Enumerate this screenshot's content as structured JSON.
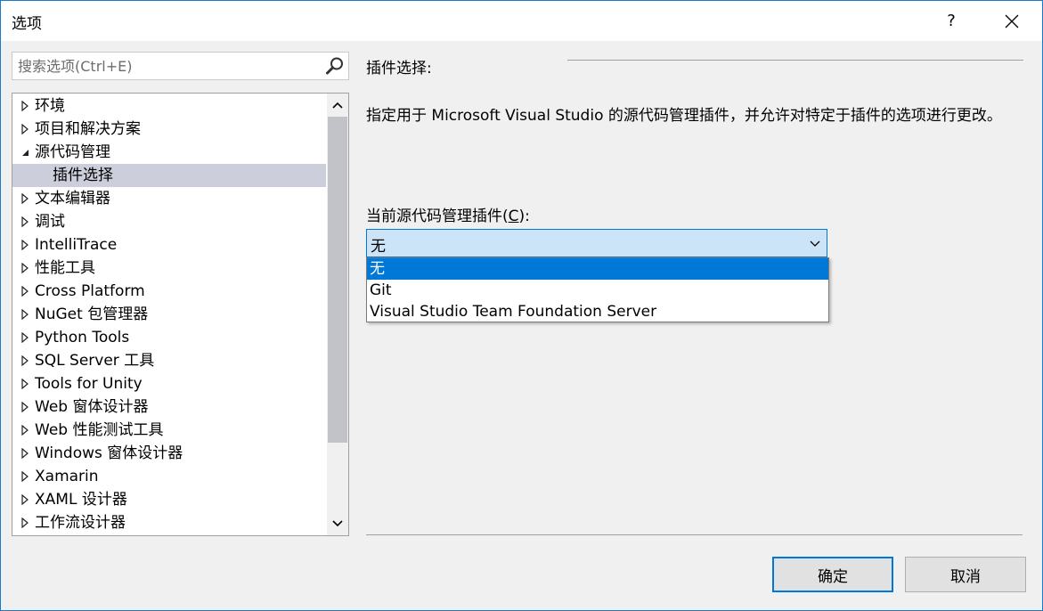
{
  "window": {
    "title": "选项",
    "help_label": "?"
  },
  "search": {
    "placeholder": "搜索选项(Ctrl+E)"
  },
  "tree": {
    "items": [
      {
        "label": "环境",
        "expanded": false,
        "child": false,
        "selected": false
      },
      {
        "label": "项目和解决方案",
        "expanded": false,
        "child": false,
        "selected": false
      },
      {
        "label": "源代码管理",
        "expanded": true,
        "child": false,
        "selected": false
      },
      {
        "label": "插件选择",
        "expanded": false,
        "child": true,
        "selected": true
      },
      {
        "label": "文本编辑器",
        "expanded": false,
        "child": false,
        "selected": false
      },
      {
        "label": "调试",
        "expanded": false,
        "child": false,
        "selected": false
      },
      {
        "label": "IntelliTrace",
        "expanded": false,
        "child": false,
        "selected": false
      },
      {
        "label": "性能工具",
        "expanded": false,
        "child": false,
        "selected": false
      },
      {
        "label": "Cross Platform",
        "expanded": false,
        "child": false,
        "selected": false
      },
      {
        "label": "NuGet 包管理器",
        "expanded": false,
        "child": false,
        "selected": false
      },
      {
        "label": "Python Tools",
        "expanded": false,
        "child": false,
        "selected": false
      },
      {
        "label": "SQL Server 工具",
        "expanded": false,
        "child": false,
        "selected": false
      },
      {
        "label": "Tools for Unity",
        "expanded": false,
        "child": false,
        "selected": false
      },
      {
        "label": "Web 窗体设计器",
        "expanded": false,
        "child": false,
        "selected": false
      },
      {
        "label": "Web 性能测试工具",
        "expanded": false,
        "child": false,
        "selected": false
      },
      {
        "label": "Windows 窗体设计器",
        "expanded": false,
        "child": false,
        "selected": false
      },
      {
        "label": "Xamarin",
        "expanded": false,
        "child": false,
        "selected": false
      },
      {
        "label": "XAML 设计器",
        "expanded": false,
        "child": false,
        "selected": false
      },
      {
        "label": "工作流设计器",
        "expanded": false,
        "child": false,
        "selected": false
      }
    ]
  },
  "panel": {
    "header": "插件选择:",
    "description": "指定用于 Microsoft Visual Studio 的源代码管理插件，并允许对特定于插件的选项进行更改。",
    "field_label_pre": "当前源代码管理插件(",
    "field_label_key": "C",
    "field_label_post": "):",
    "combo_value": "无",
    "options": [
      "无",
      "Git",
      "Visual Studio Team Foundation Server"
    ]
  },
  "buttons": {
    "ok": "确定",
    "cancel": "取消"
  },
  "colors": {
    "accent": "#0078d7",
    "selection": "#cccedb",
    "window_border": "#1979ca"
  }
}
